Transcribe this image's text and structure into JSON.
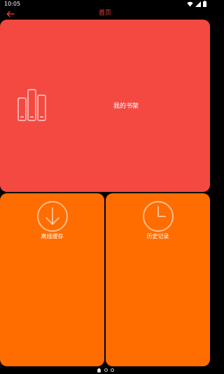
{
  "status_bar": {
    "time": "10:05",
    "icons": [
      "wifi-icon",
      "signal-icon",
      "battery-icon"
    ]
  },
  "app_bar": {
    "title": "首页",
    "back_icon": "arrow-left-icon",
    "accent_color": "#f44336"
  },
  "tiles": {
    "bookshelf": {
      "label": "我的书架",
      "icon": "books-icon",
      "color": "#f44940"
    },
    "offline": {
      "label": "离线缓存",
      "icon": "download-circle-icon",
      "color": "#ff6d00"
    },
    "history": {
      "label": "历史记录",
      "icon": "clock-icon",
      "color": "#ff6d00"
    }
  },
  "page_indicator": {
    "current": "home",
    "items": [
      "home-icon",
      "dot",
      "dot"
    ]
  }
}
